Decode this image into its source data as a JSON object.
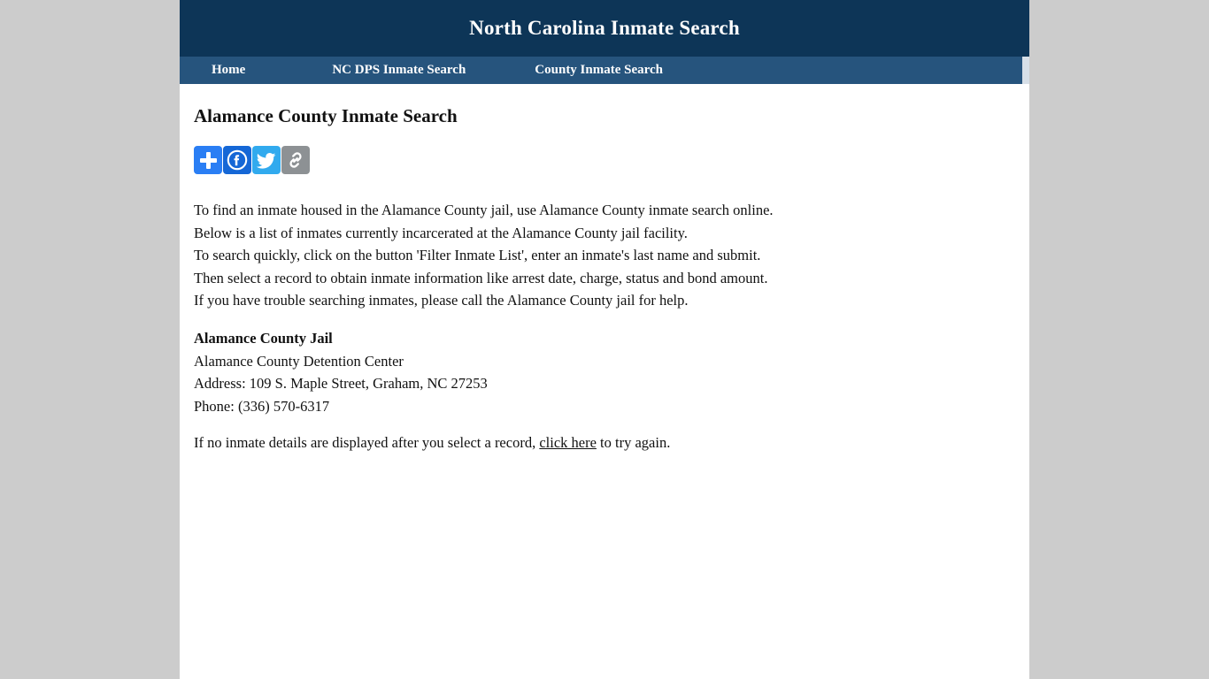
{
  "site": {
    "title": "North Carolina Inmate Search",
    "header_bg": "#0d3557",
    "nav_bg": "#26547d",
    "page_bg": "#ffffff",
    "outer_bg": "#cccccc"
  },
  "nav": {
    "items": [
      {
        "label": "Home",
        "name": "nav-item-home"
      },
      {
        "label": "NC DPS Inmate Search",
        "name": "nav-item-nc-dps-inmate-search"
      },
      {
        "label": "County Inmate Search",
        "name": "nav-item-county-inmate-search"
      }
    ]
  },
  "main": {
    "page_title": "Alamance County Inmate Search",
    "share_buttons": [
      {
        "icon": "addthis-plus-icon",
        "label": "",
        "color": "#2a7ef4"
      },
      {
        "icon": "facebook-icon",
        "label": "Facebook",
        "color": "#1567d6"
      },
      {
        "icon": "twitter-icon",
        "label": "Twitter",
        "color": "#31aaee"
      },
      {
        "icon": "copy-link-icon",
        "label": "",
        "color": "#8d9194"
      }
    ],
    "intro_lines": [
      "To find an inmate housed in the Alamance County jail, use Alamance County inmate search online.",
      "Below is a list of inmates currently incarcerated at the Alamance County jail facility.",
      "To search quickly, click on the button 'Filter Inmate List', enter an inmate's last name and submit.",
      "Then select a record to obtain inmate information like arrest date, charge, status and bond amount.",
      "If you have trouble searching inmates, please call the Alamance County jail for help."
    ],
    "jail": {
      "name": "Alamance County Jail",
      "facility": "Alamance County Detention Center",
      "address": "Address: 109 S. Maple Street, Graham, NC 27253",
      "phone": "Phone: (336) 570-6317"
    },
    "footer_note": {
      "before": "If no inmate details are displayed after you select a record, ",
      "link": "click here",
      "after": " to try again."
    }
  }
}
